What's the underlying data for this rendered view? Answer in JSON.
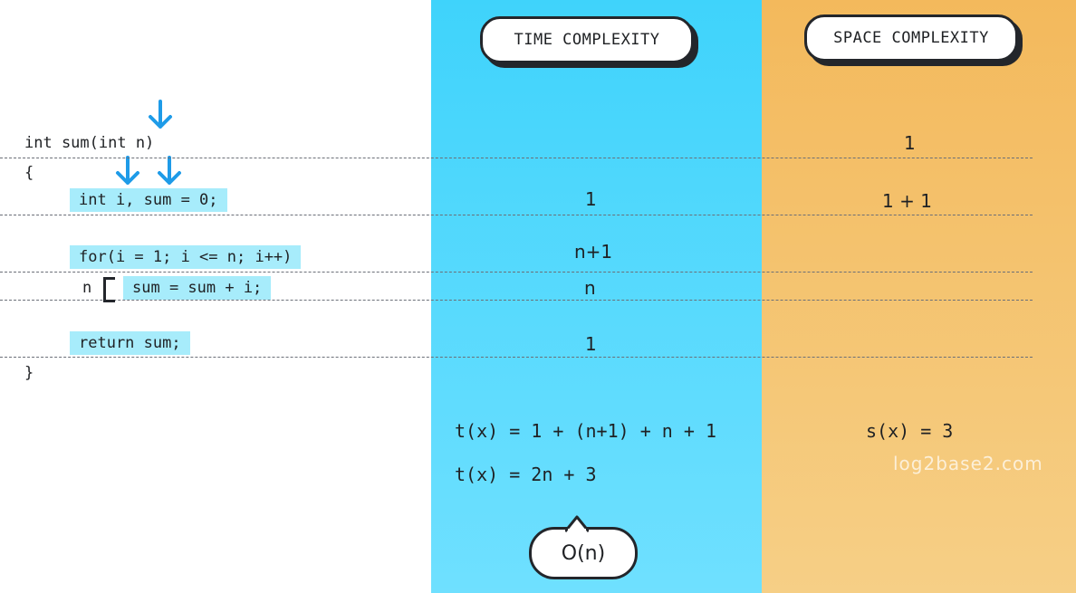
{
  "headers": {
    "time": "TIME COMPLEXITY",
    "space": "SPACE COMPLEXITY"
  },
  "code": {
    "signature": "int sum(int n)",
    "open_brace": "{",
    "line_decl": "int i, sum = 0;",
    "line_for": "for(i = 1; i <= n; i++)",
    "loop_var": "n",
    "line_body": "sum = sum + i;",
    "line_return": "return sum;",
    "close_brace": "}"
  },
  "time_cells": {
    "decl": "1",
    "for": "n+1",
    "body": "n",
    "return": "1"
  },
  "space_cells": {
    "signature": "1",
    "decl": "1 + 1"
  },
  "formulas": {
    "time_1": "t(x) = 1 + (n+1) + n + 1",
    "time_2": "t(x) = 2n + 3",
    "space_1": "s(x) = 3"
  },
  "result": "O(n)",
  "watermark": "log2base2.com",
  "colors": {
    "time_column": "#3fd3fb",
    "space_column": "#f3b95c",
    "highlight": "#a7ecfb",
    "arrow": "#1e9be8"
  },
  "icons": [
    "arrow-down-icon"
  ]
}
